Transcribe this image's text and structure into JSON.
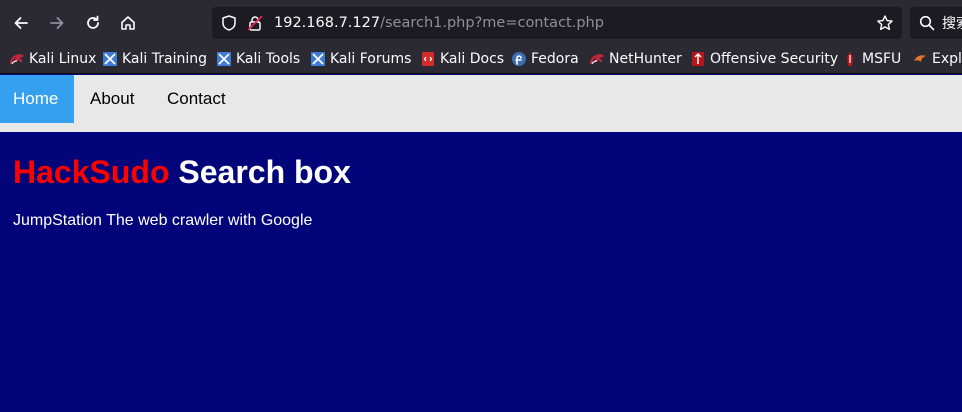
{
  "browser": {
    "url": {
      "host": "192.168.7.127",
      "path": "/search1.php?me=contact.php"
    },
    "search_placeholder": "搜索"
  },
  "bookmarks": [
    {
      "label": "Kali Linux",
      "icon": "kali-dragon-icon",
      "color": "#c3273d"
    },
    {
      "label": "Kali Training",
      "icon": "kali-training-icon",
      "color": "#3e7bd4"
    },
    {
      "label": "Kali Tools",
      "icon": "kali-tools-icon",
      "color": "#3e7bd4"
    },
    {
      "label": "Kali Forums",
      "icon": "kali-forums-icon",
      "color": "#3e7bd4"
    },
    {
      "label": "Kali Docs",
      "icon": "kali-docs-icon",
      "color": "#d42a2a"
    },
    {
      "label": "Fedora",
      "icon": "fedora-icon",
      "color": "#3c6eb4"
    },
    {
      "label": "NetHunter",
      "icon": "nethunter-icon",
      "color": "#c3273d"
    },
    {
      "label": "Offensive Security",
      "icon": "offsec-icon",
      "color": "#b5161c"
    },
    {
      "label": "MSFU",
      "icon": "msfu-icon",
      "color": "#b5161c"
    },
    {
      "label": "Explo",
      "icon": "exploit-db-icon",
      "color": "#e4732b"
    }
  ],
  "site": {
    "nav": [
      {
        "label": "Home",
        "active": true
      },
      {
        "label": "About",
        "active": false
      },
      {
        "label": "Contact",
        "active": false
      }
    ],
    "title_brand": "HackSudo",
    "title_rest": " Search box",
    "subtitle": "JumpStation The web crawler with Google",
    "colors": {
      "background": "#020479",
      "nav_bg": "#e8e8e8",
      "nav_active": "#35a0ef",
      "brand": "#ff0000"
    }
  }
}
